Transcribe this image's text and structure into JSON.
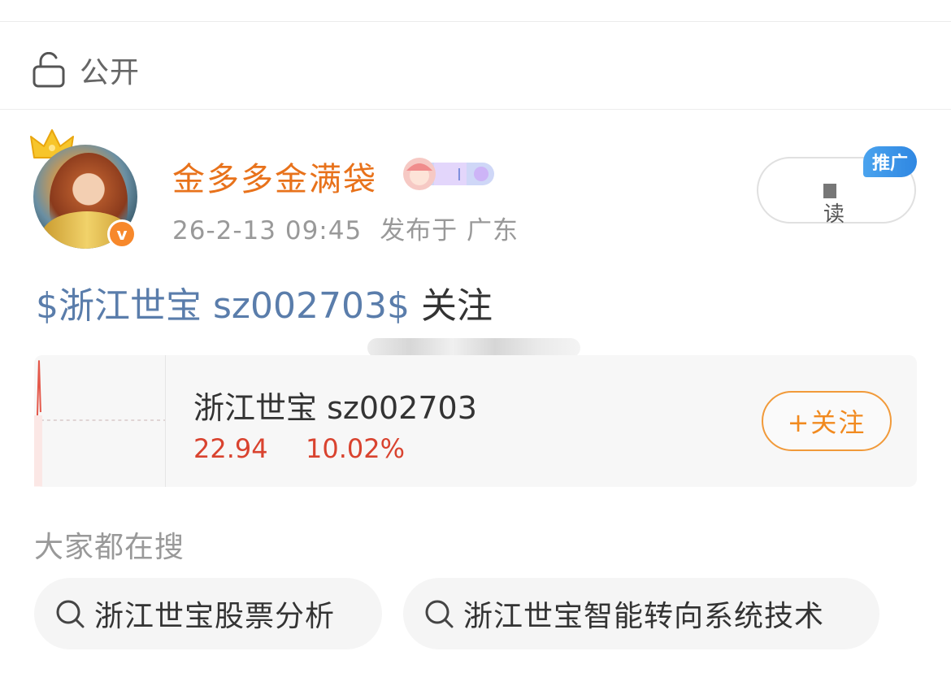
{
  "visibility": {
    "label": "公开"
  },
  "author": {
    "name": "金多多金满袋",
    "verified_mark": "v",
    "timestamp": "26-2-13 09:45",
    "location": "发布于 广东"
  },
  "promotion": {
    "button_text": "读",
    "tag": "推广"
  },
  "post": {
    "stock_link": "$浙江世宝 sz002703$",
    "trailing_text": " 关注"
  },
  "stock_card": {
    "name": "浙江世宝 sz002703",
    "price": "22.94",
    "change": "10.02%",
    "follow_button": "+关注",
    "color_up": "#d9432f"
  },
  "search": {
    "heading": "大家都在搜",
    "items": [
      {
        "label": "浙江世宝股票分析"
      },
      {
        "label": "浙江世宝智能转向系统技术"
      }
    ]
  },
  "colors": {
    "accent": "#e8721b",
    "link": "#5a7dab",
    "promo_tag": "#2f87e2"
  }
}
